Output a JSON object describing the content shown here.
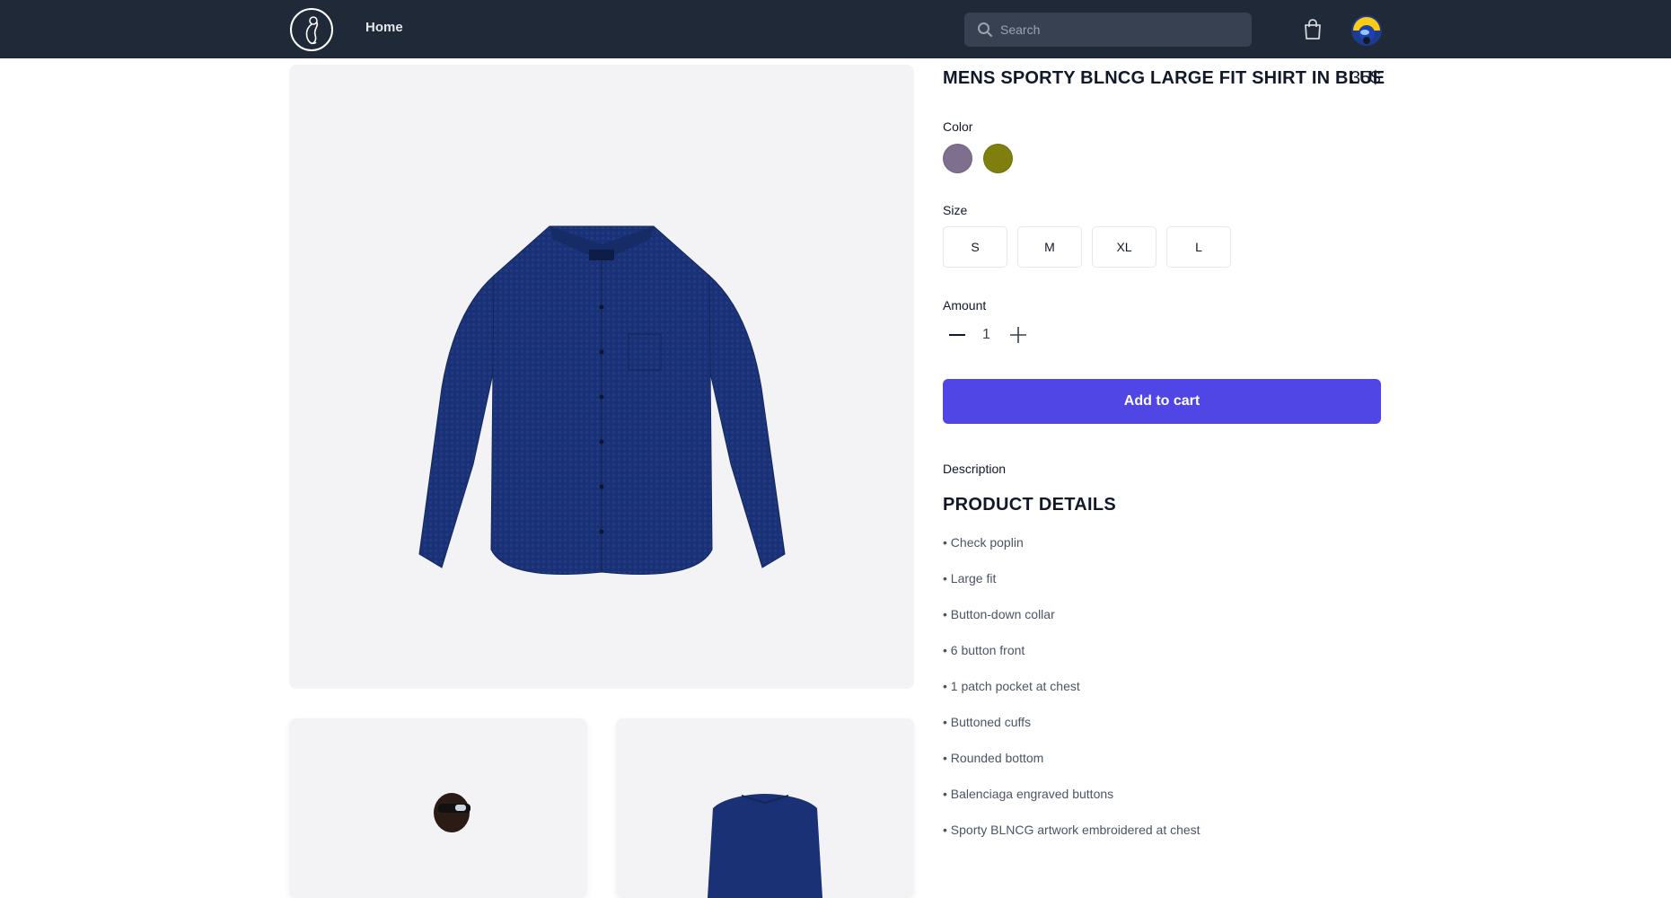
{
  "navbar": {
    "home_label": "Home",
    "search_placeholder": "Search",
    "icons": {
      "logo": "brand-logo-icon",
      "search": "search-icon",
      "cart": "shopping-bag-icon",
      "avatar": "user-avatar"
    },
    "background": "#1f2937"
  },
  "product": {
    "title": "MENS SPORTY BLNCG LARGE FIT SHIRT IN BLUE",
    "price": "35$",
    "color_label": "Color",
    "colors": [
      "#7e6f8e",
      "#7f7f0d"
    ],
    "size_label": "Size",
    "sizes": [
      "S",
      "M",
      "XL",
      "L"
    ],
    "amount_label": "Amount",
    "amount": "1",
    "add_to_cart": "Add to cart",
    "accent_color": "#4f46e5",
    "description_label": "Description",
    "details_heading": "PRODUCT DETAILS",
    "details": [
      "• Check poplin",
      "• Large fit",
      "• Button-down collar",
      "• 6 button front",
      "• 1 patch pocket at chest",
      "• Buttoned cuffs",
      "• Rounded bottom",
      "• Balenciaga engraved buttons",
      "• Sporty BLNCG artwork embroidered at chest"
    ]
  }
}
